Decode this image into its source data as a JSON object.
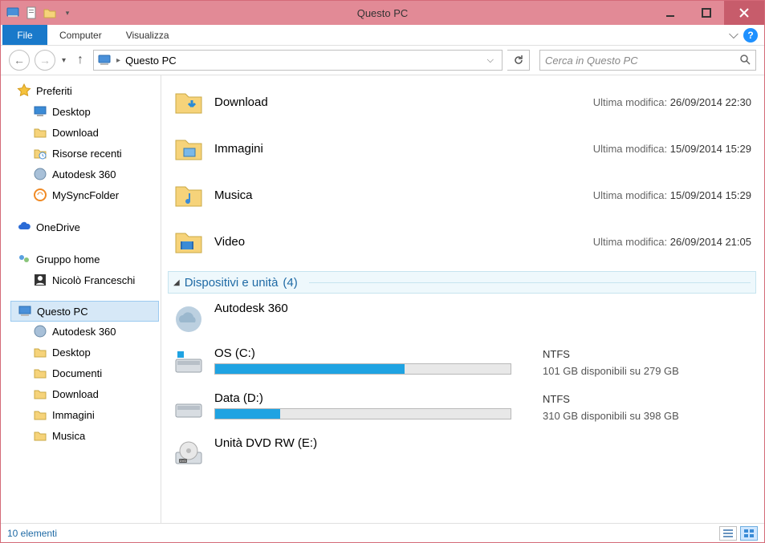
{
  "window": {
    "title": "Questo PC"
  },
  "ribbon": {
    "file_label": "File",
    "tabs": [
      "Computer",
      "Visualizza"
    ]
  },
  "nav": {
    "breadcrumb": "Questo PC",
    "search_placeholder": "Cerca in Questo PC"
  },
  "sidebar": {
    "favorites": {
      "label": "Preferiti",
      "items": [
        "Desktop",
        "Download",
        "Risorse recenti",
        "Autodesk 360",
        "MySyncFolder"
      ]
    },
    "onedrive": {
      "label": "OneDrive"
    },
    "homegroup": {
      "label": "Gruppo home",
      "items": [
        "Nicolò Franceschi"
      ]
    },
    "thispc": {
      "label": "Questo PC",
      "items": [
        "Autodesk 360",
        "Desktop",
        "Documenti",
        "Download",
        "Immagini",
        "Musica"
      ]
    }
  },
  "folders": [
    {
      "name": "Download",
      "meta_label": "Ultima modifica:",
      "meta_value": "26/09/2014 22:30"
    },
    {
      "name": "Immagini",
      "meta_label": "Ultima modifica:",
      "meta_value": "15/09/2014 15:29"
    },
    {
      "name": "Musica",
      "meta_label": "Ultima modifica:",
      "meta_value": "15/09/2014 15:29"
    },
    {
      "name": "Video",
      "meta_label": "Ultima modifica:",
      "meta_value": "26/09/2014 21:05"
    }
  ],
  "devices_group": {
    "label": "Dispositivi e unità",
    "count": "(4)"
  },
  "devices": [
    {
      "kind": "cloud",
      "name": "Autodesk 360"
    },
    {
      "kind": "drive",
      "name": "OS (C:)",
      "fs": "NTFS",
      "free_text": "101 GB disponibili su 279 GB",
      "fill_pct": 64
    },
    {
      "kind": "drive",
      "name": "Data (D:)",
      "fs": "NTFS",
      "free_text": "310 GB disponibili su 398 GB",
      "fill_pct": 22
    },
    {
      "kind": "dvd",
      "name": "Unità DVD RW (E:)"
    }
  ],
  "status": {
    "text": "10 elementi"
  }
}
